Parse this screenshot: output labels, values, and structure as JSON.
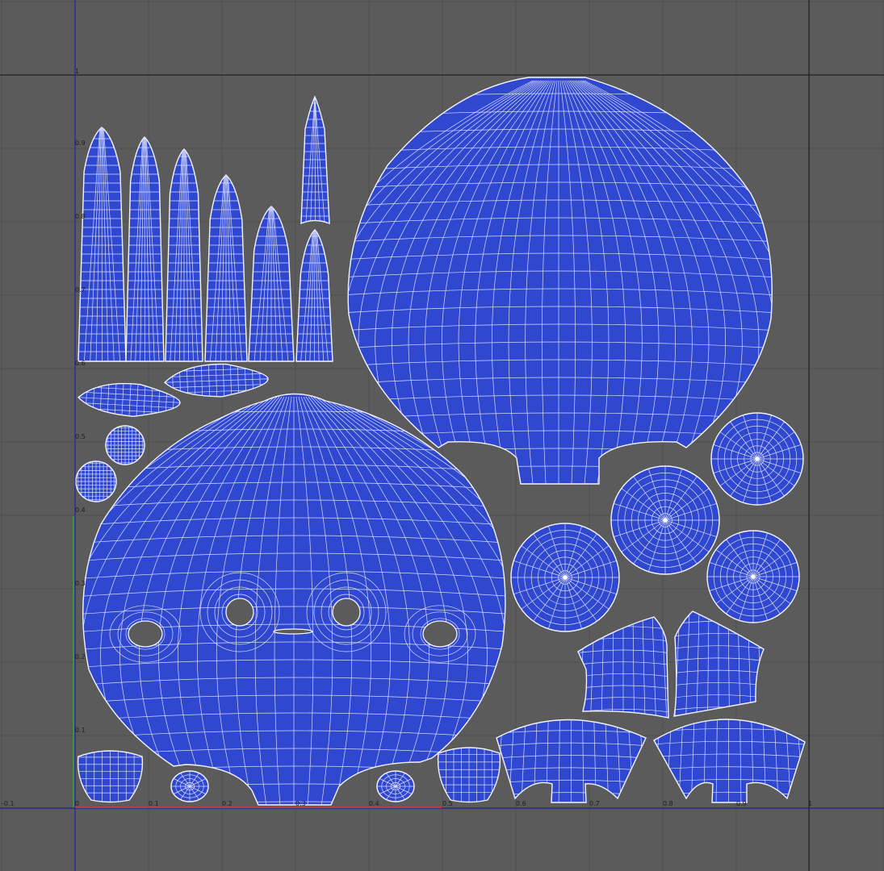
{
  "uv_editor": {
    "background_color": "#5b5b5b",
    "grid_color": "#4f4f4f",
    "shell_fill_color": "#2f48cf",
    "wire_color": "#f4f4ff",
    "axis_colors": {
      "u": "#c23a3a",
      "v": "#3aa33a",
      "frame": "#1a1aa8"
    },
    "labels": {
      "origin": "0",
      "u_neg": "-0.1",
      "u_ticks": [
        "0.1",
        "0.2",
        "0.3",
        "0.4",
        "0.5",
        "0.6",
        "0.7",
        "0.8",
        "0.9",
        "1"
      ],
      "v_ticks": [
        "0.1",
        "0.2",
        "0.3",
        "0.4",
        "0.5",
        "0.6",
        "0.7",
        "0.8",
        "0.9",
        "1"
      ]
    }
  }
}
